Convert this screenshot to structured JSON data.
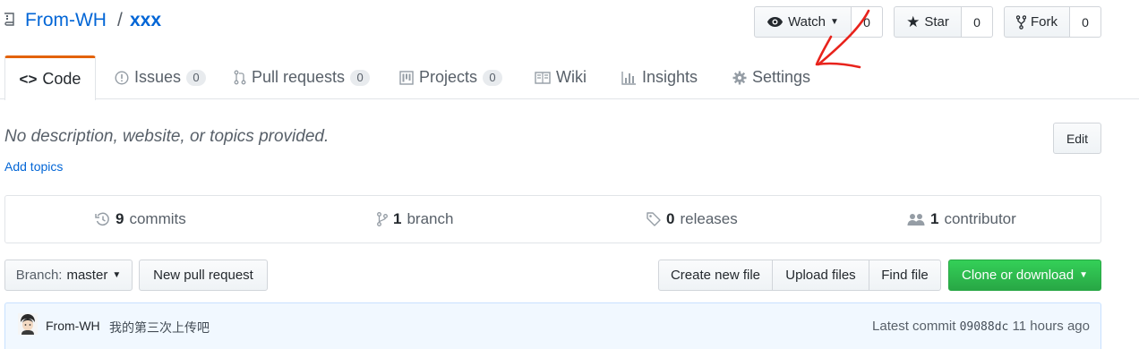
{
  "header": {
    "owner": "From-WH",
    "separator": "/",
    "repo": "xxx"
  },
  "actions": {
    "watch_label": "Watch",
    "watch_count": "0",
    "star_label": "Star",
    "star_count": "0",
    "fork_label": "Fork",
    "fork_count": "0"
  },
  "tabs": [
    {
      "label": "Code",
      "icon": "code-icon"
    },
    {
      "label": "Issues",
      "count": "0",
      "icon": "issue-opened-icon"
    },
    {
      "label": "Pull requests",
      "count": "0",
      "icon": "git-pull-request-icon"
    },
    {
      "label": "Projects",
      "count": "0",
      "icon": "project-icon"
    },
    {
      "label": "Wiki",
      "icon": "book-icon"
    },
    {
      "label": "Insights",
      "icon": "graph-icon"
    },
    {
      "label": "Settings",
      "icon": "gear-icon"
    }
  ],
  "description": {
    "text": "No description, website, or topics provided.",
    "edit_label": "Edit",
    "add_topics": "Add topics"
  },
  "summary": {
    "commits_count": "9",
    "commits_label": "commits",
    "branch_count": "1",
    "branch_label": "branch",
    "releases_count": "0",
    "releases_label": "releases",
    "contributors_count": "1",
    "contributors_label": "contributor"
  },
  "toolbar": {
    "branch_prefix": "Branch:",
    "branch_name": "master",
    "new_pr": "New pull request",
    "create_file": "Create new file",
    "upload_files": "Upload files",
    "find_file": "Find file",
    "clone": "Clone or download"
  },
  "commit": {
    "author": "From-WH",
    "message": "我的第三次上传吧",
    "latest_label": "Latest commit",
    "sha": "09088dc",
    "time": "11 hours ago"
  },
  "colors": {
    "link": "#0366d6",
    "tab_accent": "#e36209",
    "clone_green": "#28a745",
    "annotation_red": "#e8231c"
  }
}
